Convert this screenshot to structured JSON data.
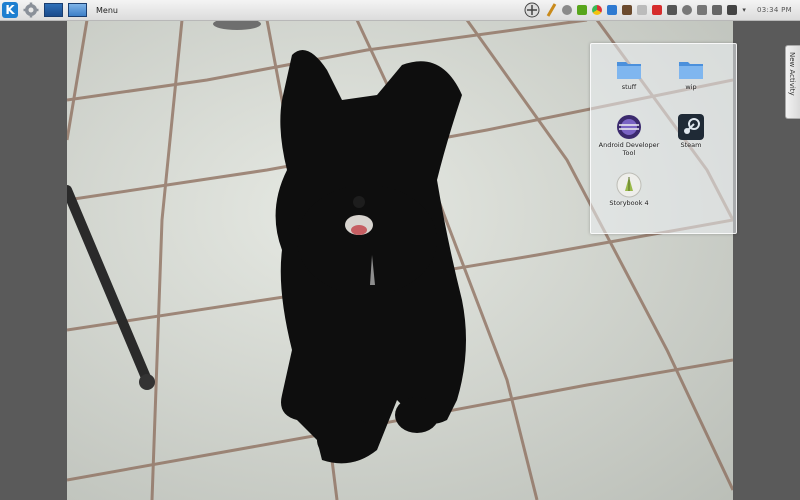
{
  "panel": {
    "menu_label": "Menu",
    "clock": "03:34 PM",
    "launcher_icon": "kde-k-icon",
    "tray_icons": [
      "network-icon",
      "pen-icon",
      "chat-icon",
      "battery-icon",
      "chrome-icon",
      "bookmark-icon",
      "files-icon",
      "cloud-icon",
      "game-icon",
      "tools-icon",
      "audio-icon",
      "sync-icon",
      "bluetooth-icon",
      "printer-icon",
      "arrow-icon"
    ]
  },
  "folderview": {
    "items": [
      {
        "label": "stuff",
        "icon": "folder-icon"
      },
      {
        "label": "wip",
        "icon": "folder-icon"
      },
      {
        "label": "Android Developer Tool",
        "icon": "eclipse-icon"
      },
      {
        "label": "Steam",
        "icon": "steam-icon"
      },
      {
        "label": "Storybook 4",
        "icon": "storybook-icon"
      }
    ]
  },
  "activity_tab": {
    "label": "New Activity"
  },
  "colors": {
    "panel": "#e6e6e6",
    "accent": "#1e7fd0",
    "sidebar": "#5a5a5a",
    "floor": "#c8cbc4"
  }
}
